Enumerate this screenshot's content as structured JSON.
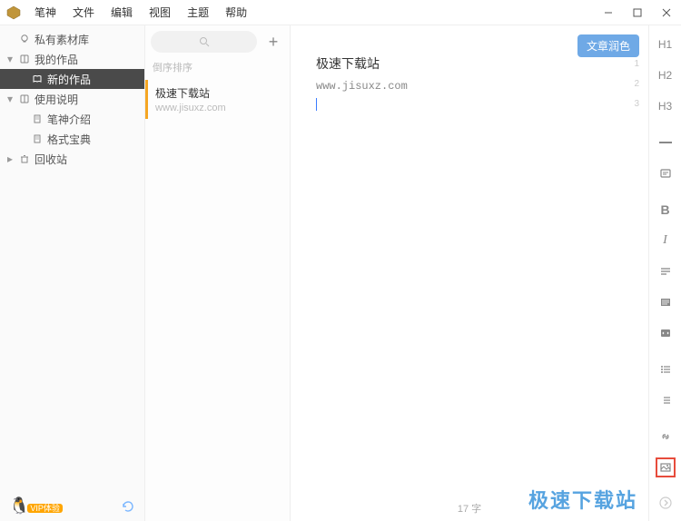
{
  "menus": [
    "笔神",
    "文件",
    "编辑",
    "视图",
    "主题",
    "帮助"
  ],
  "sidebar": {
    "personal_lib": "私有素材库",
    "my_works": "我的作品",
    "new_work": "新的作品",
    "usage_guide": "使用说明",
    "bishen_intro": "笔神介绍",
    "format_ref": "格式宝典",
    "trash": "回收站",
    "vip_label": "VIP体验"
  },
  "list": {
    "sort": "倒序排序",
    "note_title": "极速下载站",
    "note_sub": "www.jisuxz.com"
  },
  "editor": {
    "polish": "文章润色",
    "title": "极速下载站",
    "line1": "www.jisuxz.com",
    "word_count": "17 字",
    "line_numbers": [
      "1",
      "2",
      "3"
    ]
  },
  "tools": {
    "h1": "H1",
    "h2": "H2",
    "h3": "H3",
    "bold": "B",
    "italic": "I"
  },
  "watermark": "极速下载站"
}
